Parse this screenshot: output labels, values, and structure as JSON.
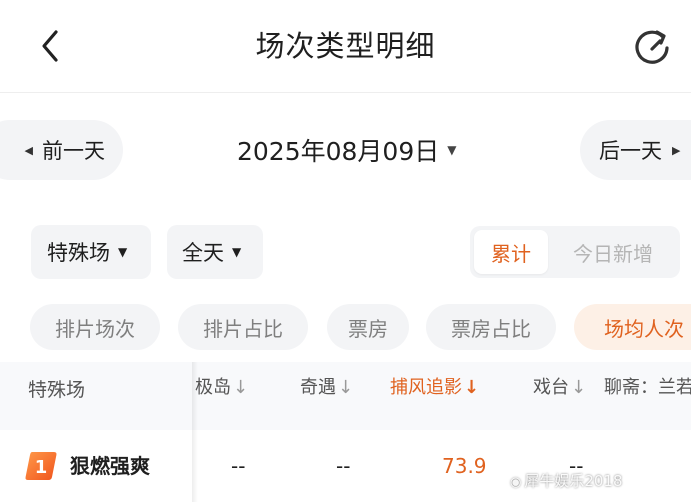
{
  "header": {
    "title": "场次类型明细",
    "back_icon": "chevron-left-icon",
    "refresh_icon": "refresh-icon"
  },
  "date_nav": {
    "prev_label": "前一天",
    "date": "2025年08月09日",
    "next_label": "后一天"
  },
  "filters": {
    "type": "特殊场",
    "time": "全天",
    "toggle": {
      "cumulative": "累计",
      "today_new": "今日新增",
      "selected": "cumulative"
    }
  },
  "metric_tabs": [
    {
      "label": "排片场次"
    },
    {
      "label": "排片占比"
    },
    {
      "label": "票房"
    },
    {
      "label": "票房占比"
    },
    {
      "label": "场均人次",
      "selected": true
    }
  ],
  "table": {
    "first_col_header": "特殊场",
    "columns": [
      {
        "label": "极岛",
        "arrow": "↓"
      },
      {
        "label": "奇遇",
        "arrow": "↓"
      },
      {
        "label": "捕风追影",
        "arrow": "↓",
        "active": true
      },
      {
        "label": "戏台",
        "arrow": "↓"
      },
      {
        "label": "聊斋：兰若"
      }
    ],
    "rows": [
      {
        "rank": "1",
        "name": "狠燃强爽",
        "values": [
          "--",
          "--",
          "73.9",
          "--"
        ]
      }
    ]
  },
  "watermark": "犀牛娱乐2018",
  "colors": {
    "accent": "#e0621f",
    "chip_bg": "#f3f4f6",
    "selected_bg": "#fdf0e6"
  }
}
